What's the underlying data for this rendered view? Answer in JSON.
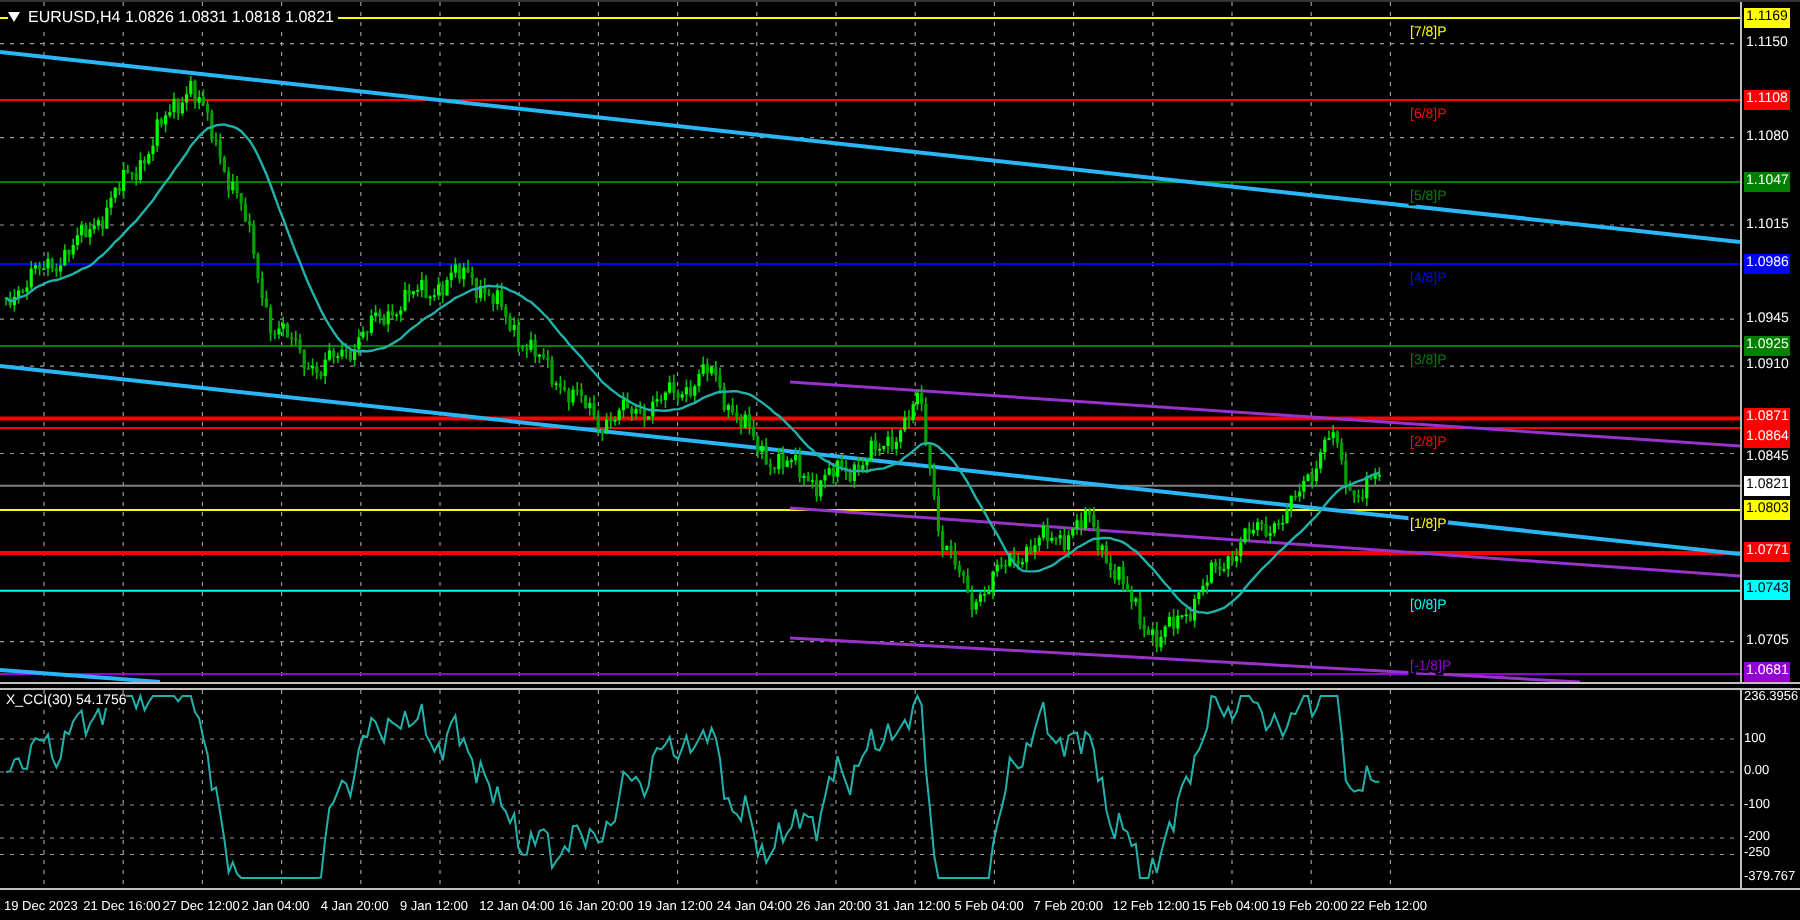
{
  "chart_header": {
    "text": "EURUSD,H4 1.0826 1.0831 1.0818 1.0821"
  },
  "murrey_levels": [
    {
      "price": "1.1169",
      "label": "[7/8]P",
      "color": "#ffff00"
    },
    {
      "price": "1.1108",
      "label": "[6/8]P",
      "color": "#ff0000"
    },
    {
      "price": "1.1047",
      "label": "[5/8]P",
      "color": "#008000"
    },
    {
      "price": "1.0986",
      "label": "[4/8]P",
      "color": "#0000ff"
    },
    {
      "price": "1.0925",
      "label": "[3/8]P",
      "color": "#008000"
    },
    {
      "price": "1.0864",
      "label": "[2/8]P",
      "color": "#ff0000"
    },
    {
      "price": "1.0803",
      "label": "[1/8]P",
      "color": "#ffff00"
    },
    {
      "price": "1.0743",
      "label": "[0/8]P",
      "color": "#00ffff"
    },
    {
      "price": "1.0681",
      "label": "[-1/8]P",
      "color": "#9400d3"
    }
  ],
  "marker_lines": [
    {
      "price": "1.0871",
      "color": "#ff0000"
    },
    {
      "price": "1.0771",
      "color": "#ff0000"
    }
  ],
  "current_price": {
    "price": "1.0821"
  },
  "price_ticks": [
    "1.1150",
    "1.1080",
    "1.1015",
    "1.0945",
    "1.0910",
    "1.0845",
    "1.0705"
  ],
  "cci": {
    "label": "X_CCI(30) 54.1756",
    "axis_labels": [
      "236.3956",
      "100",
      "0.00",
      "-100",
      "-200",
      "-250",
      "-379.767"
    ]
  },
  "time_axis": [
    "19 Dec 2023",
    "21 Dec 16:00",
    "27 Dec 12:00",
    "2 Jan 04:00",
    "4 Jan 20:00",
    "9 Jan 12:00",
    "12 Jan 04:00",
    "16 Jan 20:00",
    "19 Jan 12:00",
    "24 Jan 04:00",
    "26 Jan 20:00",
    "31 Jan 12:00",
    "5 Feb 04:00",
    "7 Feb 20:00",
    "12 Feb 12:00",
    "15 Feb 04:00",
    "19 Feb 20:00",
    "22 Feb 12:00"
  ]
}
